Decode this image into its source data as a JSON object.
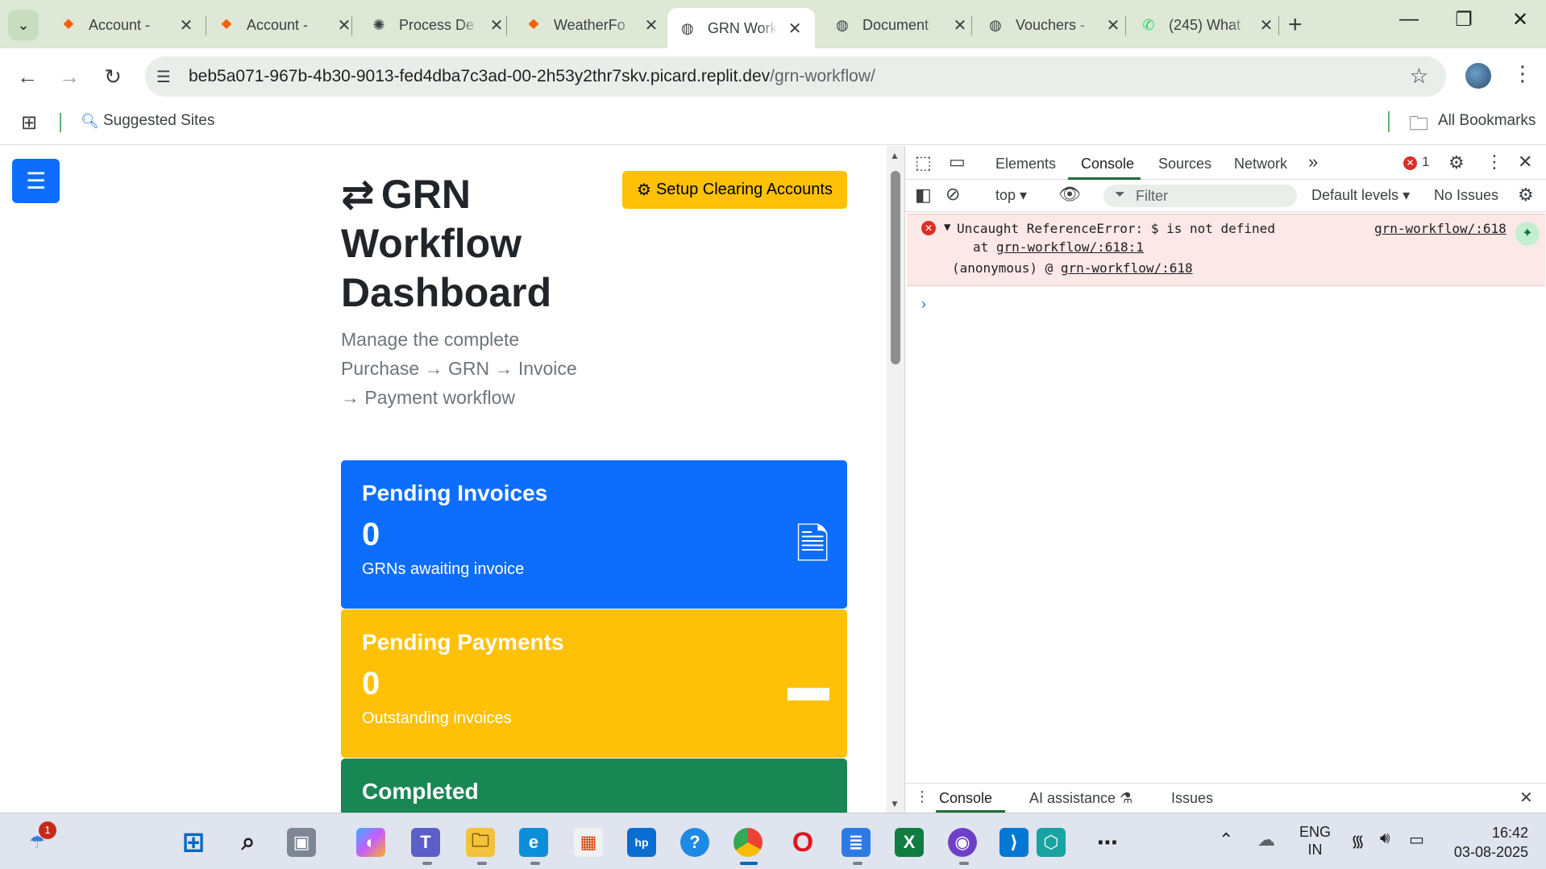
{
  "browser": {
    "tabs": [
      {
        "title": "Account - ",
        "icon": "replit-icon",
        "active": false
      },
      {
        "title": "Account - ",
        "icon": "replit-icon",
        "active": false
      },
      {
        "title": "Process De",
        "icon": "chatgpt-icon",
        "active": false
      },
      {
        "title": "WeatherFo",
        "icon": "replit-icon",
        "active": false
      },
      {
        "title": "GRN Work",
        "icon": "globe-icon",
        "active": true
      },
      {
        "title": "Document",
        "icon": "globe-icon",
        "active": false
      },
      {
        "title": "Vouchers -",
        "icon": "globe-icon",
        "active": false
      },
      {
        "title": "(245) What",
        "icon": "whatsapp-icon",
        "active": false
      }
    ],
    "url_host": "beb5a071-967b-4b30-9013-fed4dba7c3ad-00-2h53y2thr7skv.picard.replit.dev",
    "url_path": "/grn-workflow/",
    "bookmarks": {
      "suggested": "Suggested Sites",
      "all": "All Bookmarks"
    }
  },
  "page": {
    "title": "GRN Workflow Dashboard",
    "subtitle": "Manage the complete Purchase → GRN → Invoice → Payment workflow",
    "setup_button": "Setup Clearing Accounts",
    "cards": [
      {
        "title": "Pending Invoices",
        "count": "0",
        "desc": "GRNs awaiting invoice",
        "color": "#0d6efd",
        "icon": "document-icon"
      },
      {
        "title": "Pending Payments",
        "count": "0",
        "desc": "Outstanding invoices",
        "color": "#ffc107",
        "icon": "credit-card-icon"
      },
      {
        "title": "Completed",
        "color": "#198754"
      }
    ]
  },
  "devtools": {
    "tabs": [
      "Elements",
      "Console",
      "Sources",
      "Network"
    ],
    "active_tab": "Console",
    "error_count": "1",
    "context": "top",
    "filter_placeholder": "Filter",
    "levels": "Default levels",
    "issues": "No Issues",
    "error": {
      "message": "Uncaught ReferenceError: $ is not defined",
      "at_prefix": "at ",
      "at_link": "grn-workflow/:618:1",
      "anon_prefix": "(anonymous) @ ",
      "anon_link": "grn-workflow/:618",
      "source": "grn-workflow/:618"
    },
    "drawer_tabs": [
      "Console",
      "AI assistance",
      "Issues"
    ]
  },
  "taskbar": {
    "notification_count": "1",
    "lang_top": "ENG",
    "lang_bottom": "IN",
    "time": "16:42",
    "date": "03-08-2025"
  }
}
